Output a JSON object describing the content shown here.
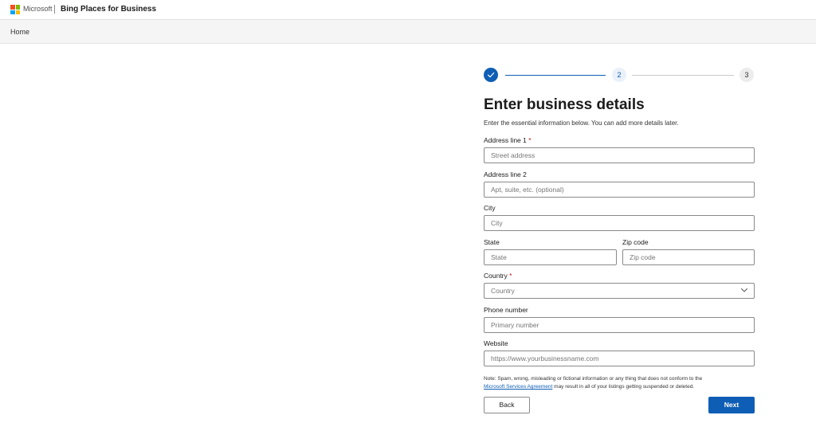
{
  "header": {
    "brand": "Microsoft",
    "product": "Bing Places for Business"
  },
  "breadcrumb": {
    "home": "Home"
  },
  "stepper": {
    "steps": [
      "",
      "2",
      "3"
    ],
    "current": 2,
    "completed_step": 1,
    "active_color": "#0f5eb5"
  },
  "form": {
    "title": "Enter business details",
    "subtitle": "Enter the essential information below. You can add more details later.",
    "required_marker": "*",
    "address1": {
      "label": "Address line 1",
      "placeholder": "Street address",
      "required": true
    },
    "address2": {
      "label": "Address line 2",
      "placeholder": "Apt, suite, etc. (optional)"
    },
    "city": {
      "label": "City",
      "placeholder": "City"
    },
    "state": {
      "label": "State",
      "placeholder": "State"
    },
    "zip": {
      "label": "Zip code",
      "placeholder": "Zip code"
    },
    "country": {
      "label": "Country",
      "value": "Country",
      "required": true
    },
    "phone": {
      "label": "Phone number",
      "placeholder": "Primary number"
    },
    "website": {
      "label": "Website",
      "placeholder": "https://www.yourbusinessname.com"
    }
  },
  "note": {
    "prefix": "Note: Spam, wrong, misleading or fictional information or any thing that does not conform to the",
    "link": "Microsoft Services Agreement",
    "suffix": "may result in all of your listings getting suspended or deleted."
  },
  "buttons": {
    "back": "Back",
    "next": "Next"
  }
}
